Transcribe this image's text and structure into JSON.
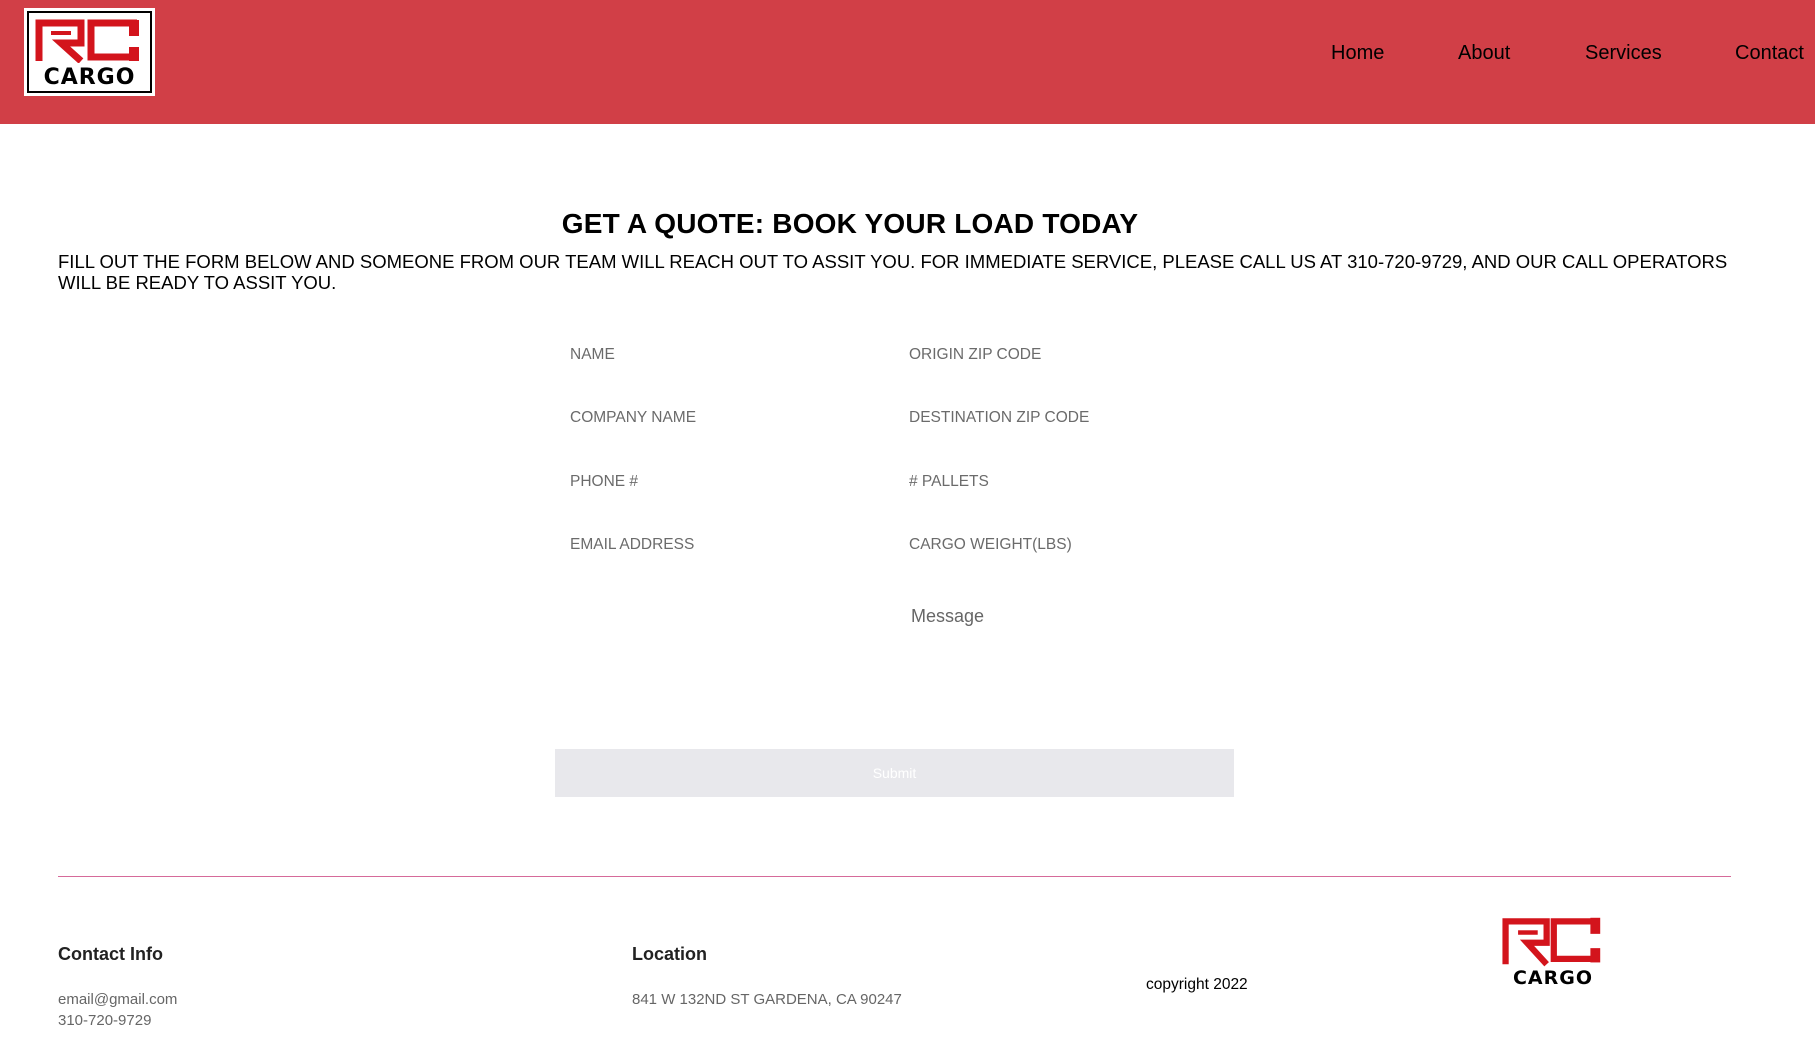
{
  "brand": {
    "logo_top": "RC",
    "logo_bottom": "CARGO",
    "header_color": "#d13f47"
  },
  "nav": {
    "home": "Home",
    "about": "About",
    "services": "Services",
    "contact": "Contact"
  },
  "main": {
    "title": "GET A QUOTE: BOOK YOUR LOAD TODAY",
    "intro": "FILL OUT THE FORM BELOW AND SOMEONE FROM OUR TEAM WILL REACH OUT TO ASSIT YOU. FOR IMMEDIATE SERVICE, PLEASE CALL US AT 310-720-9729, AND OUR CALL OPERATORS WILL BE READY TO ASSIT YOU."
  },
  "form": {
    "name_placeholder": "NAME",
    "company_placeholder": "COMPANY NAME",
    "phone_placeholder": "PHONE #",
    "email_placeholder": "EMAIL ADDRESS",
    "origin_placeholder": "ORIGIN ZIP CODE",
    "destination_placeholder": "DESTINATION ZIP CODE",
    "pallets_placeholder": "# PALLETS",
    "weight_placeholder": "CARGO WEIGHT(LBS)",
    "message_placeholder": "Message",
    "submit_label": "Submit"
  },
  "footer": {
    "contact_heading": "Contact Info",
    "email": "email@gmail.com",
    "phone": "310-720-9729",
    "location_heading": "Location",
    "address": "841 W 132ND ST GARDENA, CA 90247",
    "copyright": "copyright 2022"
  }
}
